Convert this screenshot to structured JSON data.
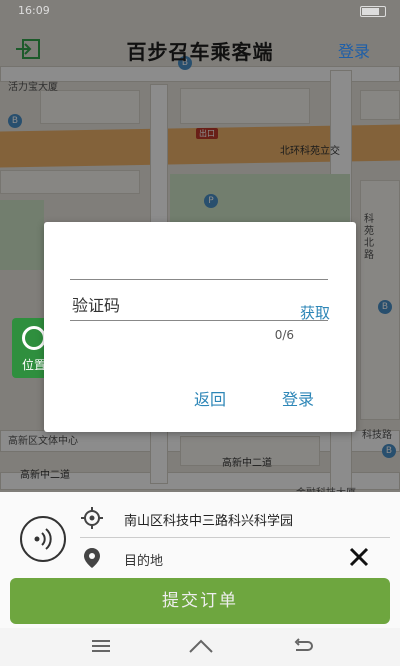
{
  "status_bar": {
    "time": "16:09"
  },
  "header": {
    "title": "百步召车乘客端",
    "login_label": "登录",
    "exit_icon": "exit-icon"
  },
  "map": {
    "labels": [
      "活力宝大厦",
      "北环科苑立交",
      "出口",
      "科苑北路",
      "高新区文体中心",
      "高新中二道",
      "金融科技大厦",
      "科技路"
    ]
  },
  "locate_button": {
    "label": "位置"
  },
  "bottom_panel": {
    "origin": "南山区科技中三路科兴科学园",
    "destination_placeholder": "目的地",
    "submit_label": "提交订单"
  },
  "dialog": {
    "phone_value": "",
    "code_label": "验证码",
    "fetch_label": "获取",
    "counter": "0/6",
    "back_label": "返回",
    "confirm_label": "登录"
  },
  "colors": {
    "accent_blue": "#2d86b7",
    "submit_green": "#6ea63f",
    "locate_green": "#2f8f3e"
  }
}
